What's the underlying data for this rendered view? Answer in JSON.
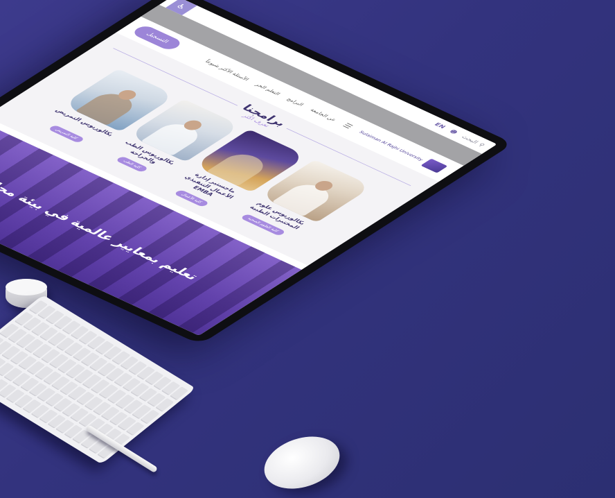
{
  "topbar": {
    "accessibility_icon": "wheelchair-icon",
    "lang": "EN",
    "user_icon": "user-icon",
    "search_placeholder": "البحث",
    "search_icon": "search-icon"
  },
  "nav": {
    "logo_text": "Sulaiman Al Rajhi University",
    "menu_icon": "menu-icon",
    "items": [
      "عن الجامعة",
      "البرامج",
      "التعلم الحر",
      "الأسئلة الأكثر شيوعاً"
    ],
    "register": "التسجيل"
  },
  "programs": {
    "title": "برامجنا",
    "subtitle": "تعرف أكثر",
    "cards": [
      {
        "title": "بكالوريوس التمريض",
        "button": "كلية التمريض"
      },
      {
        "title": "بكالوريوس الطب والجراحة",
        "button": "كلية الطب"
      },
      {
        "title": "ماجستير إدارة الأعمال التنفيذي EMBA",
        "button": "كلية الأعمال"
      },
      {
        "title": "بكالوريوس علوم المختبرات الطبية",
        "button": "كلية العلوم الصحية"
      }
    ]
  },
  "hero": {
    "text": "تعليم بمعايير عالمية في بيئة محلية"
  },
  "colors": {
    "brand_purple": "#6b5ca8",
    "accent_lavender": "#a78be0",
    "background": "#3a3888"
  }
}
